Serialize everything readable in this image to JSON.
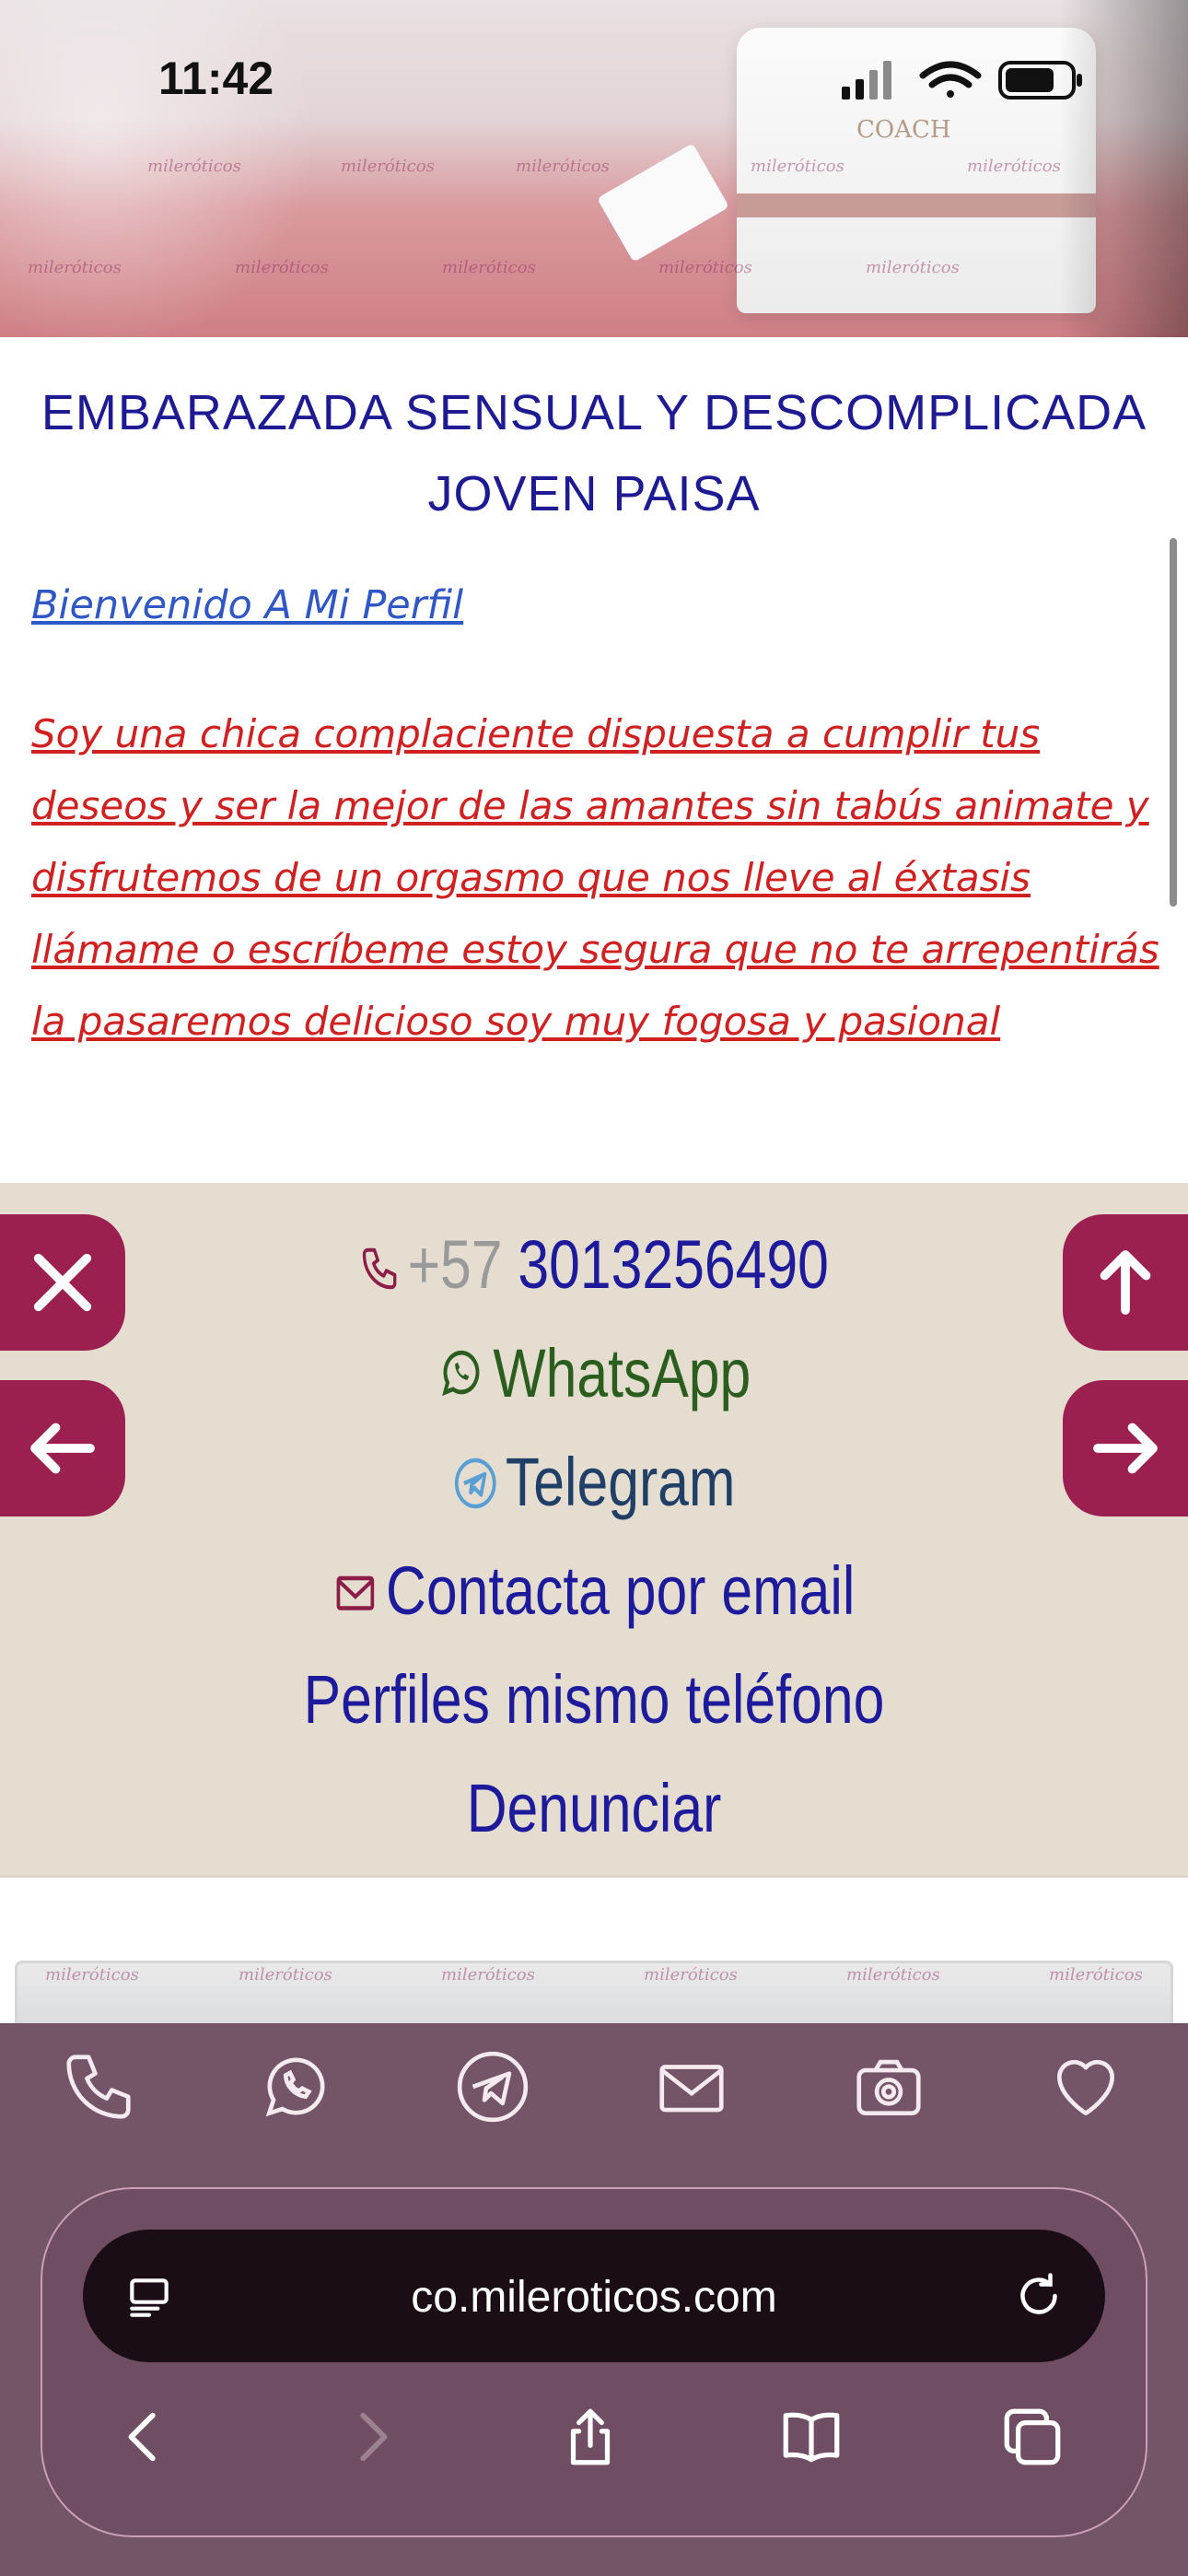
{
  "status_bar": {
    "time": "11:42"
  },
  "hero": {
    "watermark": "mileróticos",
    "bag_text": "COACH"
  },
  "ad": {
    "title": "EMBARAZADA SENSUAL Y DESCOMPLICADA JOVEN PAISA",
    "welcome": "Bienvenido A Mi Perfil",
    "description": "Soy una chica complaciente dispuesta a cumplir tus deseos y ser la mejor de las amantes sin tabús animate y disfrutemos de un orgasmo que nos lleve al éxtasis llámame o escríbeme estoy segura que no te arrepentirás la pasaremos delicioso soy muy fogosa y pasional"
  },
  "contact": {
    "phone_prefix": "+57",
    "phone_number": "3013256490",
    "whatsapp": "WhatsApp",
    "telegram": "Telegram",
    "email": "Contacta por email",
    "same_phone": "Perfiles mismo teléfono",
    "report": "Denunciar"
  },
  "browser": {
    "url": "co.mileroticos.com"
  },
  "colors": {
    "title": "#1e1a93",
    "welcome": "#2f57c5",
    "description": "#d02020",
    "contact_bg": "#e6ddd1",
    "fab": "#9b1f4f",
    "toolbar": "#735567",
    "urlbar": "#1b0d16"
  },
  "icons": {
    "toolbar": [
      "phone-icon",
      "whatsapp-icon",
      "telegram-icon",
      "mail-icon",
      "camera-icon",
      "heart-icon"
    ],
    "fabs": [
      "close-icon",
      "arrow-left-icon",
      "arrow-up-icon",
      "arrow-right-icon"
    ],
    "browser": [
      "reader-icon",
      "reload-icon",
      "back-icon",
      "forward-icon",
      "share-icon",
      "bookmarks-icon",
      "tabs-icon"
    ]
  }
}
